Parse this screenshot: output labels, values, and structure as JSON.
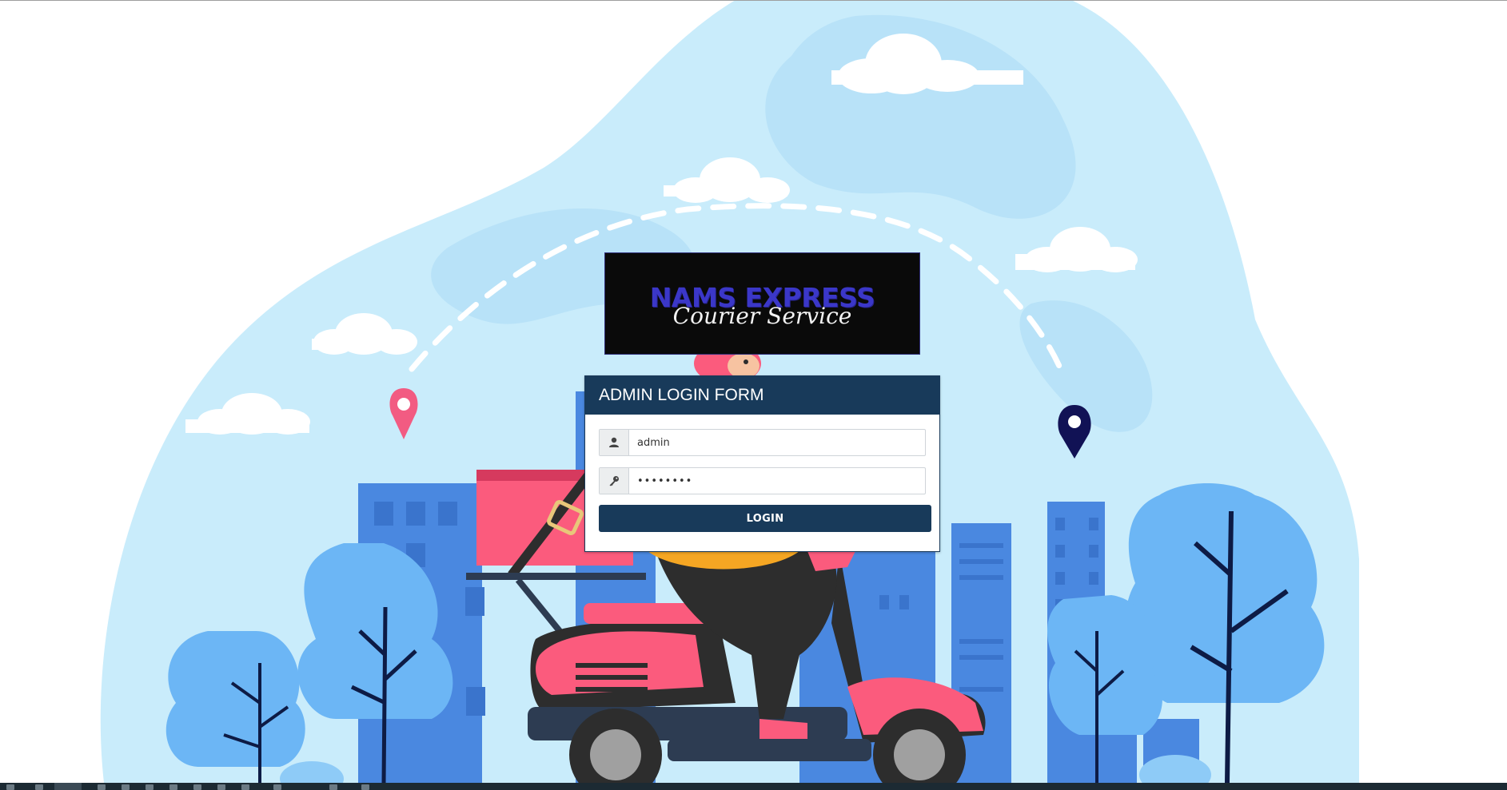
{
  "logo": {
    "title": "NAMS EXPRESS",
    "subtitle": "Courier Service"
  },
  "login_form": {
    "header": "ADMIN LOGIN FORM",
    "username_value": "admin",
    "password_value": "••••••••",
    "submit_label": "LOGIN"
  },
  "icons": {
    "user": "user-icon",
    "key": "key-icon",
    "pin_left": "location-pin-icon",
    "pin_right": "location-pin-icon"
  },
  "colors": {
    "primary": "#183a5a",
    "sky": "#c9ecfb",
    "building": "#4a88e0",
    "tree": "#6cb6f5",
    "accent_pink": "#fb5b7d",
    "pin_pink": "#f25b82",
    "pin_navy": "#111255"
  }
}
